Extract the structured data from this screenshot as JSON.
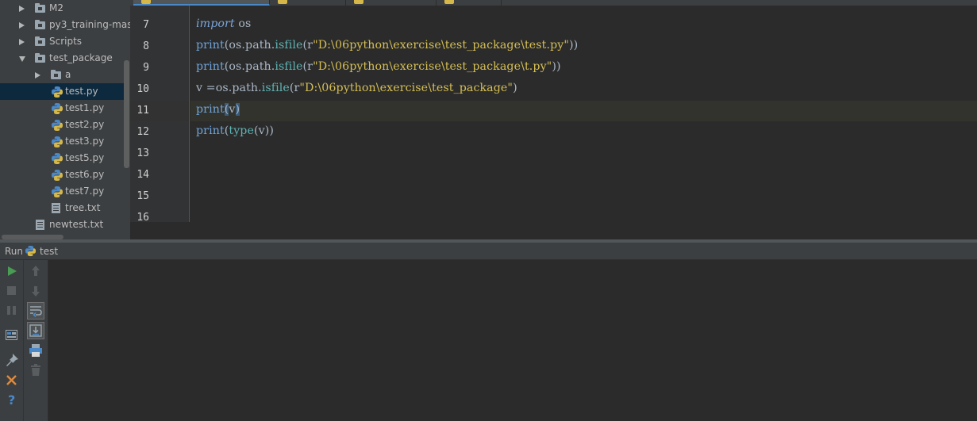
{
  "project_tree": {
    "items": [
      {
        "label": "M2",
        "kind": "folder",
        "state": "collapsed"
      },
      {
        "label": "py3_training-mast",
        "kind": "folder",
        "state": "collapsed"
      },
      {
        "label": "Scripts",
        "kind": "folder",
        "state": "collapsed"
      },
      {
        "label": "test_package",
        "kind": "folder",
        "state": "expanded"
      },
      {
        "label": "a",
        "kind": "folder",
        "state": "collapsed"
      },
      {
        "label": "test.py",
        "kind": "python-file",
        "selected": true
      },
      {
        "label": "test1.py",
        "kind": "python-file"
      },
      {
        "label": "test2.py",
        "kind": "python-file"
      },
      {
        "label": "test3.py",
        "kind": "python-file"
      },
      {
        "label": "test5.py",
        "kind": "python-file"
      },
      {
        "label": "test6.py",
        "kind": "python-file"
      },
      {
        "label": "test7.py",
        "kind": "python-file"
      },
      {
        "label": "tree.txt",
        "kind": "text-file"
      },
      {
        "label": "newtest.txt",
        "kind": "text-file"
      }
    ]
  },
  "editor": {
    "line_numbers": [
      "7",
      "8",
      "9",
      "10",
      "11",
      "12",
      "13",
      "14",
      "15",
      "16"
    ],
    "current_line": "11",
    "lines": [
      {
        "kw": "import",
        "rest": " os"
      },
      {
        "b": "print",
        "a": "(os.path.",
        "fn": "isfile",
        "p": "(r",
        "s": "\"D:\\06python\\exercise\\test_package\\test.py\"",
        "e": "))"
      },
      {
        "b": "print",
        "a": "(os.path.",
        "fn": "isfile",
        "p": "(r",
        "s": "\"D:\\06python\\exercise\\test_package\\t.py\"",
        "e": "))"
      },
      {
        "a": "v =os.path.",
        "fn": "isfile",
        "p": "(r",
        "s": "\"D:\\06python\\exercise\\test_package\"",
        "e": ")"
      },
      {
        "b": "print",
        "open": "(",
        "arg": "v",
        "close": ")"
      },
      {
        "b": "print",
        "a": "(",
        "fn": "type",
        "e": "(v))"
      }
    ]
  },
  "run_panel": {
    "title": "Run",
    "config_name": "test"
  },
  "colors": {
    "background": "#2b2b2b",
    "panel": "#3c3f41",
    "selection": "#0d293e",
    "accent": "#4a88c7",
    "string": "#d6bf55",
    "keyword": "#7aa6da",
    "run_green": "#499c54",
    "close_orange": "#e08a3c"
  },
  "icons": [
    "folder-icon",
    "python-file-icon",
    "text-file-icon",
    "run-icon",
    "stop-icon",
    "pause-icon",
    "layout-icon",
    "pin-icon",
    "close-icon",
    "help-icon",
    "up-arrow-icon",
    "down-arrow-icon",
    "soft-wrap-icon",
    "scroll-to-end-icon",
    "print-icon",
    "trash-icon"
  ]
}
